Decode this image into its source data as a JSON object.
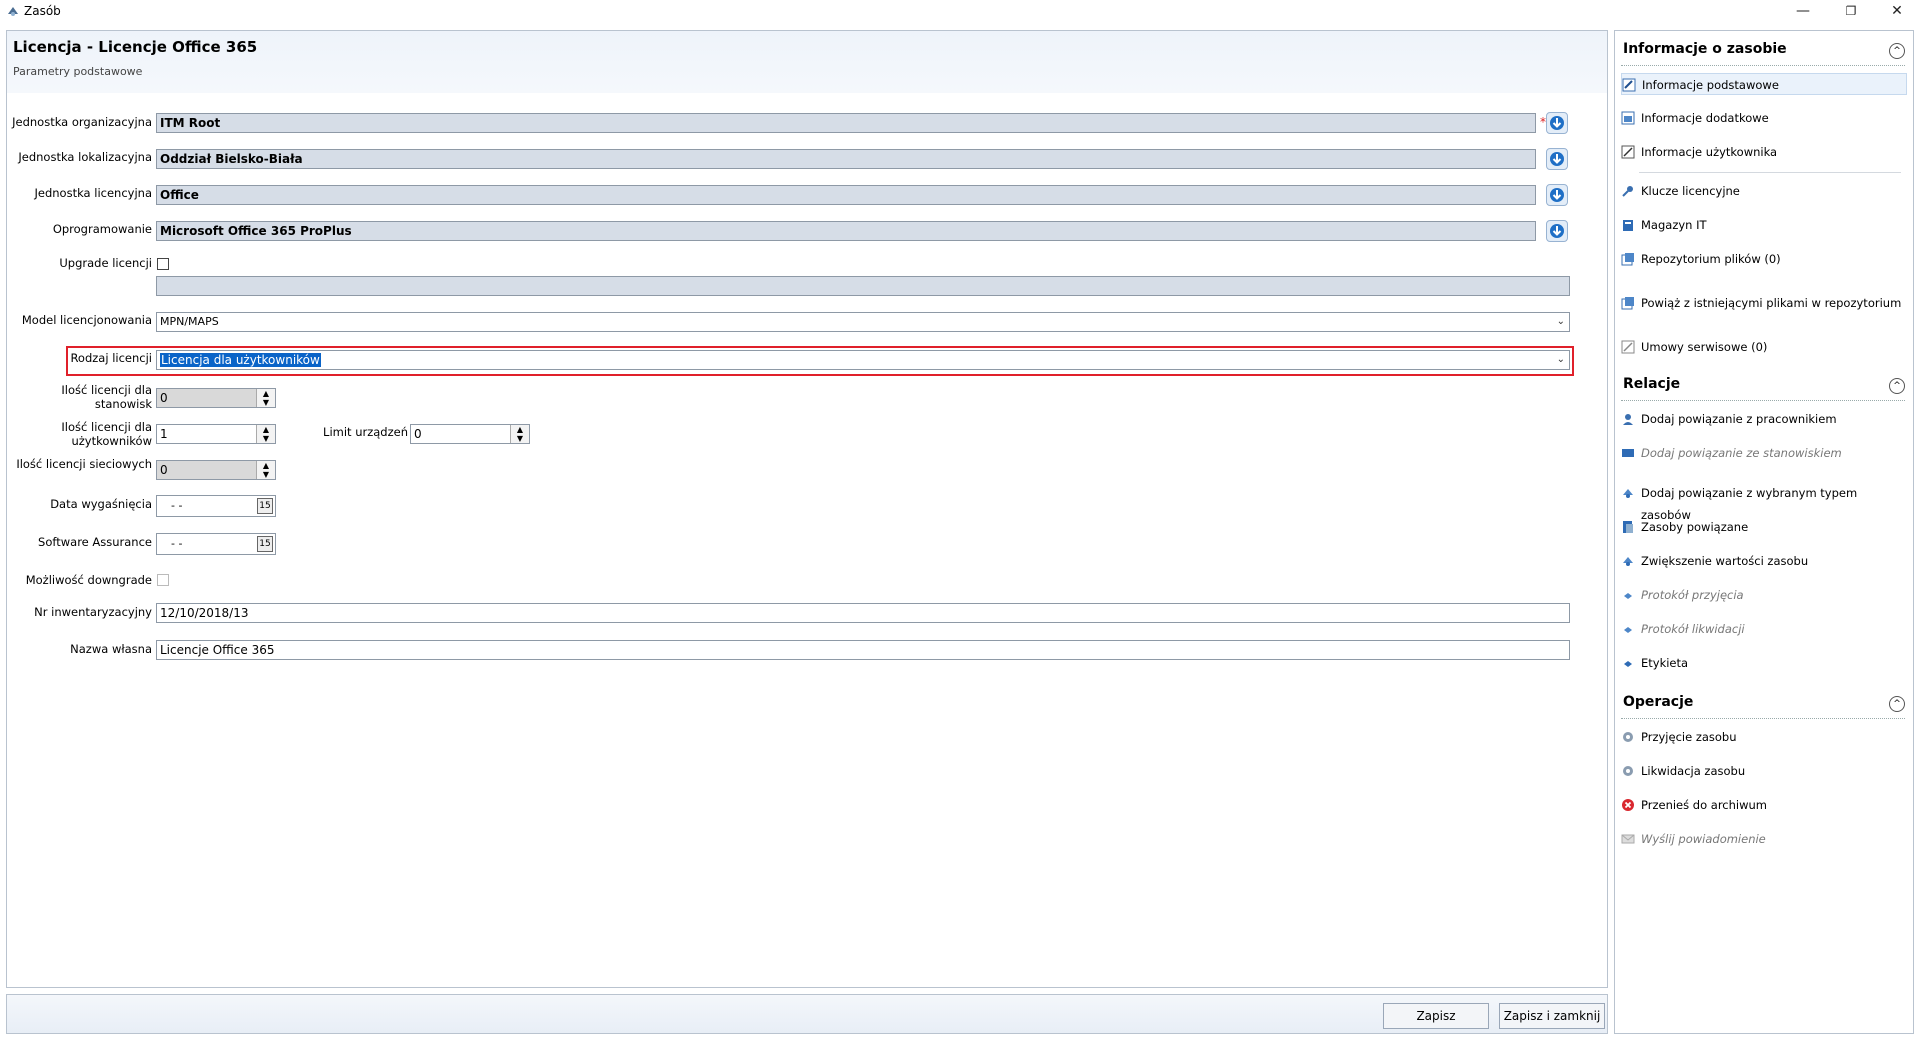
{
  "window": {
    "title": "Zasób",
    "minimize": "—",
    "maximize": "❐",
    "close": "✕"
  },
  "header": {
    "title": "Licencja - Licencje Office 365",
    "subtitle": "Parametry podstawowe"
  },
  "form": {
    "org_unit_label": "Jednostka organizacyjna",
    "org_unit_value": "ITM Root",
    "required_mark": "*",
    "loc_unit_label": "Jednostka lokalizacyjna",
    "loc_unit_value": "Oddział Bielsko-Biała",
    "lic_unit_label": "Jednostka licencyjna",
    "lic_unit_value": "Office",
    "software_label": "Oprogramowanie",
    "software_value": "Microsoft Office 365 ProPlus",
    "upgrade_label": "Upgrade licencji",
    "model_label": "Model licencjonowania",
    "model_value": "MPN/MAPS",
    "type_label": "Rodzaj licencji",
    "type_value": "Licencja dla użytkowników",
    "qty_stations_label_1": "Ilość licencji dla",
    "qty_stations_label_2": "stanowisk",
    "qty_stations_value": "0",
    "qty_users_label_1": "Ilość licencji dla",
    "qty_users_label_2": "użytkowników",
    "qty_users_value": "1",
    "device_limit_label": "Limit urządzeń",
    "device_limit_value": "0",
    "qty_network_label": "Ilość licencji sieciowych",
    "qty_network_value": "0",
    "expiry_label": "Data wygaśnięcia",
    "expiry_value": "-   -",
    "sa_label": "Software Assurance",
    "sa_value": "-   -",
    "downgrade_label": "Możliwość downgrade",
    "inventory_label": "Nr inwentaryzacyjny",
    "inventory_value": "12/10/2018/13",
    "name_label": "Nazwa własna",
    "name_value": "Licencje Office 365"
  },
  "footer": {
    "save": "Zapisz",
    "save_close": "Zapisz i zamknij"
  },
  "sidebar": {
    "info_title": "Informacje o zasobie",
    "info_items": [
      "Informacje podstawowe",
      "Informacje dodatkowe",
      "Informacje użytkownika",
      "Klucze licencyjne",
      "Magazyn IT",
      "Repozytorium plików (0)",
      "Powiąż z istniejącymi plikami w repozytorium",
      "Umowy serwisowe (0)"
    ],
    "rel_title": "Relacje",
    "rel_items": [
      "Dodaj powiązanie z pracownikiem",
      "Dodaj powiązanie ze stanowiskiem",
      "Dodaj powiązanie z wybranym typem zasobów",
      "Zasoby powiązane",
      "Zwiększenie wartości zasobu",
      "Protokół przyjęcia",
      "Protokół likwidacji",
      "Etykieta"
    ],
    "ops_title": "Operacje",
    "ops_items": [
      "Przyjęcie zasobu",
      "Likwidacja zasobu",
      "Przenieś do archiwum",
      "Wyślij powiadomienie"
    ]
  },
  "colors": {
    "accent": "#0a64c8",
    "highlight": "#e0202a",
    "readonly_field": "#d6dde7"
  }
}
